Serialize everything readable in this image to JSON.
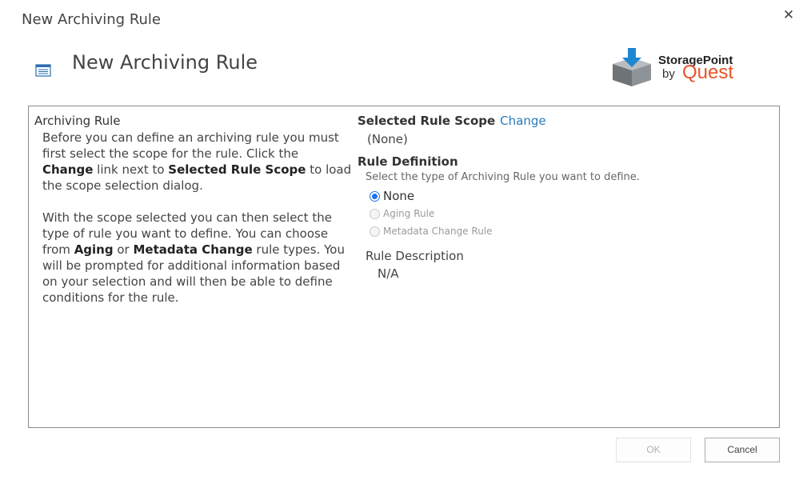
{
  "dialog": {
    "title": "New Archiving Rule",
    "close_symbol": "✕"
  },
  "header": {
    "title": "New Archiving Rule"
  },
  "logo": {
    "brand_line1": "StoragePoint",
    "brand_by": "by",
    "brand_company": "Quest",
    "accent_color": "#e8542a",
    "icon": "storagepoint-box-icon"
  },
  "left": {
    "section_label": "Archiving Rule",
    "p1_a": "Before you can define an archiving rule you must first select the scope for the rule. Click the ",
    "p1_b": "Change",
    "p1_c": " link next to ",
    "p1_d": "Selected Rule Scope",
    "p1_e": " to load the scope selection dialog.",
    "p2_a": "With the scope selected you can then select the type of rule you want to define. You can choose from ",
    "p2_b": "Aging",
    "p2_c": " or ",
    "p2_d": "Metadata Change",
    "p2_e": " rule types. You will be prompted for additional information based on your selection and will then be able to define conditions for the rule."
  },
  "right": {
    "scope_label": "Selected Rule Scope",
    "change_link": "Change",
    "scope_value": "(None)",
    "definition_label": "Rule Definition",
    "definition_prompt": "Select the type of Archiving Rule you want to define.",
    "options": [
      {
        "label": "None",
        "checked": true,
        "enabled": true
      },
      {
        "label": "Aging Rule",
        "checked": false,
        "enabled": false
      },
      {
        "label": "Metadata Change Rule",
        "checked": false,
        "enabled": false
      }
    ],
    "description_label": "Rule Description",
    "description_value": "N/A"
  },
  "buttons": {
    "ok": "OK",
    "cancel": "Cancel"
  }
}
